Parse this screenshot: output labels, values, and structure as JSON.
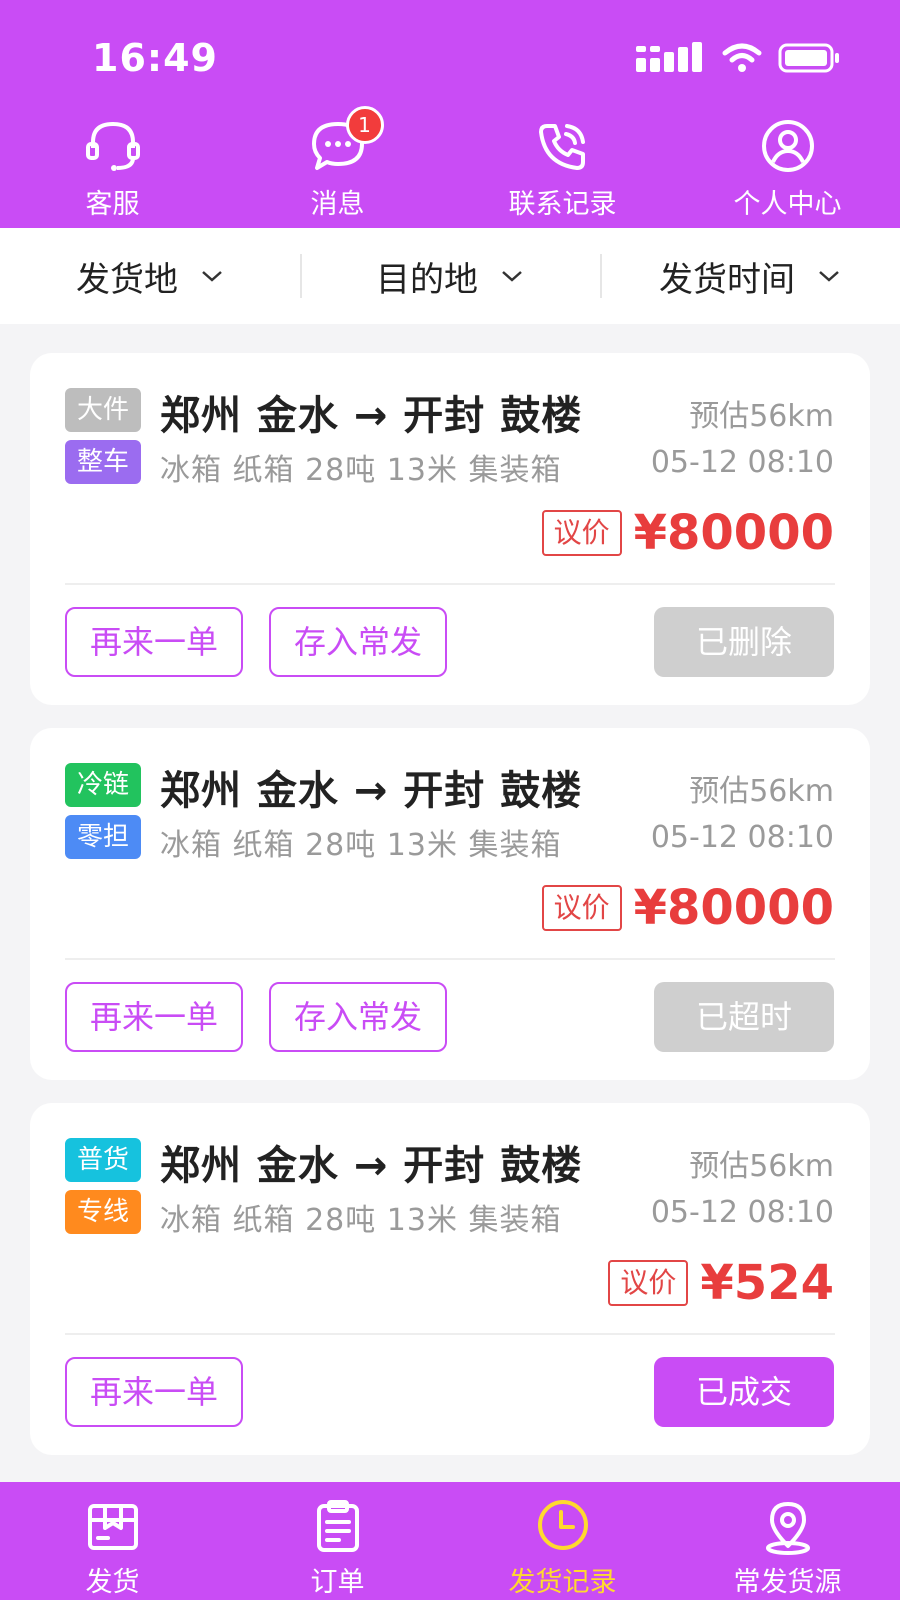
{
  "status_bar": {
    "time": "16:49"
  },
  "quick_nav": [
    {
      "label": "客服",
      "icon": "headset-icon"
    },
    {
      "label": "消息",
      "icon": "chat-icon",
      "badge": "1"
    },
    {
      "label": "联系记录",
      "icon": "phone-icon"
    },
    {
      "label": "个人中心",
      "icon": "user-icon"
    }
  ],
  "filters": [
    {
      "label": "发货地"
    },
    {
      "label": "目的地"
    },
    {
      "label": "发货时间"
    }
  ],
  "orders": [
    {
      "tag1": {
        "label": "大件",
        "color": "#bdbdbd"
      },
      "tag2": {
        "label": "整车",
        "color": "#9b6cf0"
      },
      "route": "郑州 金水 → 开封 鼓楼",
      "distance": "预估56km",
      "cargo": "冰箱 纸箱 28吨 13米  集装箱",
      "time": "05-12 08:10",
      "negotiable": "议价",
      "price": "¥80000",
      "again_label": "再来一单",
      "save_label": "存入常发",
      "status": "已删除"
    },
    {
      "tag1": {
        "label": "冷链",
        "color": "#22c35e"
      },
      "tag2": {
        "label": "零担",
        "color": "#4d8bf5"
      },
      "route": "郑州 金水 → 开封 鼓楼",
      "distance": "预估56km",
      "cargo": "冰箱 纸箱 28吨 13米  集装箱",
      "time": "05-12 08:10",
      "negotiable": "议价",
      "price": "¥80000",
      "again_label": "再来一单",
      "save_label": "存入常发",
      "status": "已超时"
    },
    {
      "tag1": {
        "label": "普货",
        "color": "#16c2de"
      },
      "tag2": {
        "label": "专线",
        "color": "#ff8a1e"
      },
      "route": "郑州 金水 → 开封 鼓楼",
      "distance": "预估56km",
      "cargo": "冰箱 纸箱 28吨 13米  集装箱",
      "time": "05-12 08:10",
      "negotiable": "议价",
      "price": "¥524",
      "again_label": "再来一单",
      "status": "已成交"
    }
  ],
  "tabs": [
    {
      "label": "发货",
      "icon": "box-icon"
    },
    {
      "label": "订单",
      "icon": "clipboard-icon"
    },
    {
      "label": "发货记录",
      "icon": "clock-icon",
      "active": true
    },
    {
      "label": "常发货源",
      "icon": "location-icon"
    }
  ],
  "colors": {
    "brand": "#c94cf5",
    "price": "#e83d3d",
    "active_tab": "#ffd92e"
  }
}
